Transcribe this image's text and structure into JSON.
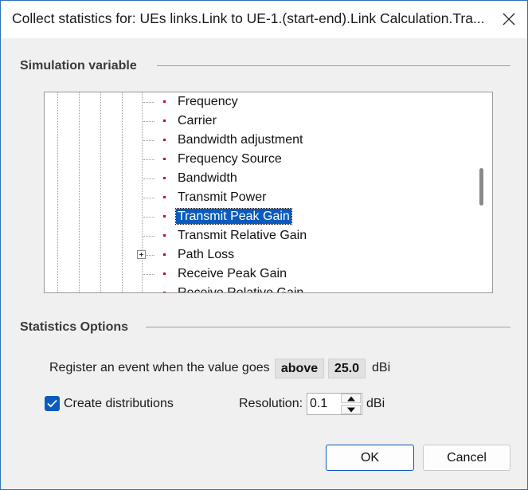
{
  "window": {
    "title": "Collect statistics for: UEs links.Link to UE-1.(start-end).Link Calculation.Tra..."
  },
  "simulation_group": {
    "label": "Simulation variable",
    "items": [
      {
        "label": "Frequency"
      },
      {
        "label": "Carrier"
      },
      {
        "label": "Bandwidth adjustment"
      },
      {
        "label": "Frequency Source"
      },
      {
        "label": "Bandwidth"
      },
      {
        "label": "Transmit Power"
      },
      {
        "label": "Transmit Peak Gain",
        "selected": true
      },
      {
        "label": "Transmit Relative Gain"
      },
      {
        "label": "Path Loss",
        "expandable": true
      },
      {
        "label": "Receive Peak Gain"
      },
      {
        "label": "Receive Relative Gain"
      }
    ]
  },
  "statistics_group": {
    "label": "Statistics Options",
    "register_text": "Register an event when the value goes",
    "direction": "above",
    "threshold": "25.0",
    "threshold_unit": "dBi",
    "create_distributions_label": "Create distributions",
    "create_distributions_checked": true,
    "resolution_label": "Resolution:",
    "resolution_value": "0.1",
    "resolution_unit": "dBi"
  },
  "buttons": {
    "ok": "OK",
    "cancel": "Cancel"
  },
  "colors": {
    "selection": "#0a5bbd",
    "bullet": "#d0021b",
    "accent_border": "#2f6fb5"
  },
  "icons": {
    "close": "close-icon",
    "check": "check-icon",
    "spin_up": "arrow-up-icon",
    "spin_down": "arrow-down-icon",
    "expand": "plus-expander-icon"
  }
}
